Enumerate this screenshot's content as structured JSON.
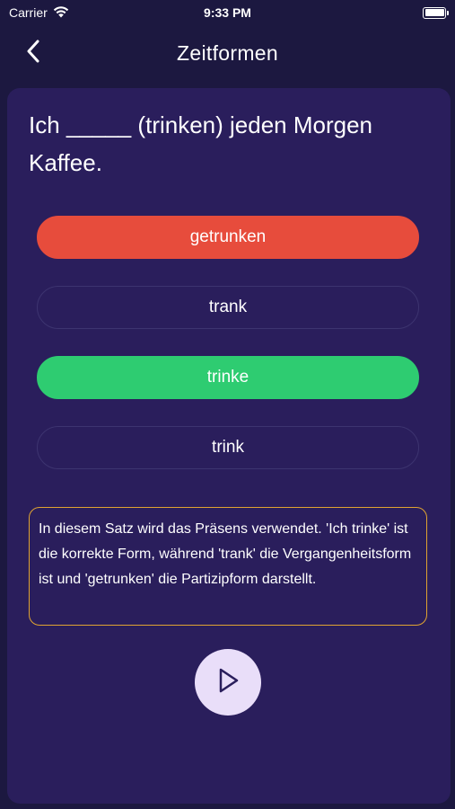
{
  "status_bar": {
    "carrier": "Carrier",
    "time": "9:33 PM"
  },
  "nav": {
    "title": "Zeitformen"
  },
  "question": {
    "text": "Ich _____ (trinken) jeden Morgen Kaffee."
  },
  "options": [
    {
      "label": "getrunken",
      "state": "wrong"
    },
    {
      "label": "trank",
      "state": "neutral"
    },
    {
      "label": "trinke",
      "state": "correct"
    },
    {
      "label": "trink",
      "state": "neutral"
    }
  ],
  "explanation": {
    "text": "In diesem Satz wird das Präsens verwendet. 'Ich trinke' ist die korrekte Form, während 'trank' die Vergangenheitsform ist und 'getrunken' die Partizipform darstellt."
  },
  "colors": {
    "background": "#1c1840",
    "card": "#2a1e5c",
    "wrong": "#e74c3c",
    "correct": "#2ecc71",
    "explanation_border": "#e0a431",
    "play_button": "#e9def9"
  },
  "icons": {
    "back": "chevron-left-icon",
    "play": "play-icon",
    "wifi": "wifi-icon",
    "battery": "battery-icon"
  }
}
